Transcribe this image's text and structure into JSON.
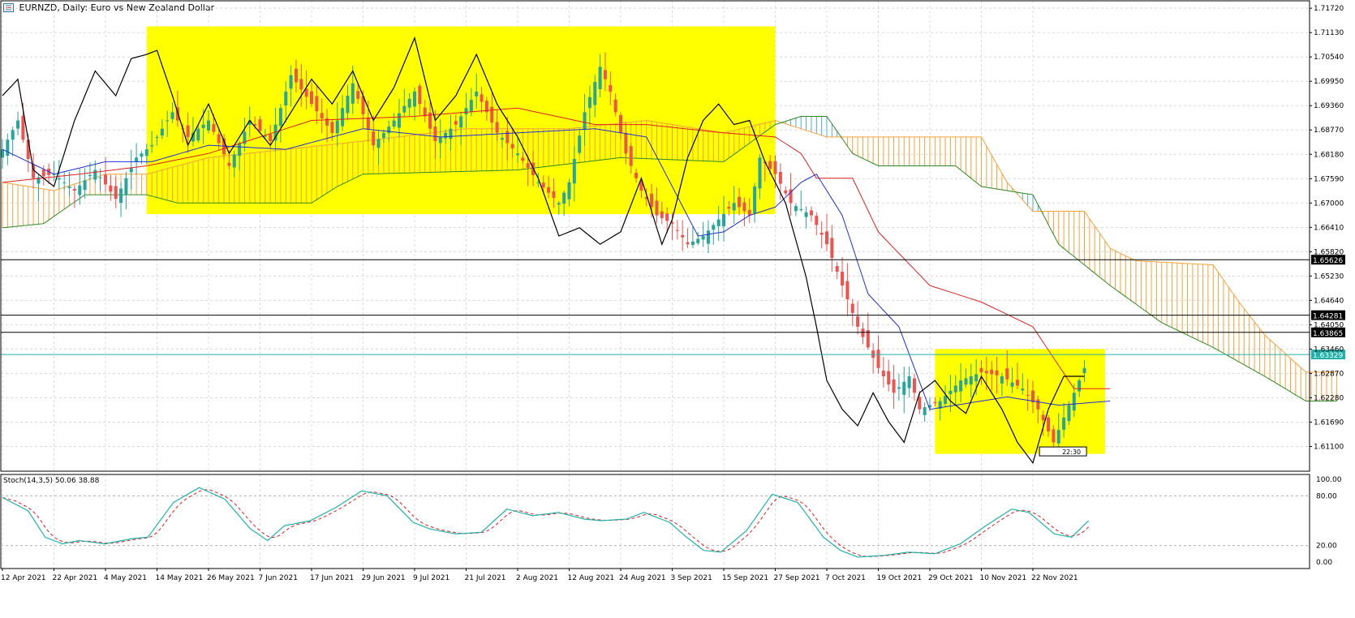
{
  "header": {
    "title": "EURNZD, Daily:  Euro vs New Zealand Dollar"
  },
  "colors": {
    "bull": "#26a69a",
    "bear": "#ef5350",
    "tenkan": "#e02020",
    "kijun": "#1f2fd6",
    "chikou": "#000000",
    "span_a": "#f5a23a",
    "span_b": "#2e8b22",
    "highlight": "#ffff00",
    "stoch_main": "#20b2aa",
    "stoch_signal": "#e02020"
  },
  "indicator": {
    "label": "Stoch(14,3,5) 50.06 38.88"
  },
  "chart_data": {
    "type": "candlestick",
    "symbol": "EURNZD",
    "timeframe": "Daily",
    "ylim": [
      1.605,
      1.719
    ],
    "price_ticks": [
      "1.71720",
      "1.71130",
      "1.70540",
      "1.69950",
      "1.69360",
      "1.68770",
      "1.68180",
      "1.67590",
      "1.67000",
      "1.66410",
      "1.65820",
      "1.65230",
      "1.64640",
      "1.64050",
      "1.63460",
      "1.62870",
      "1.62280",
      "1.61690",
      "1.61100"
    ],
    "hlines": [
      {
        "label": "1.65626",
        "value": 1.65626,
        "color": "#000000"
      },
      {
        "label": "1.64281",
        "value": 1.64281,
        "color": "#000000"
      },
      {
        "label": "1.63865",
        "value": 1.63865,
        "color": "#000000"
      },
      {
        "label": "1.63329",
        "value": 1.63329,
        "color": "#20b2aa"
      }
    ],
    "date_labels": [
      "12 Apr 2021",
      "22 Apr 2021",
      "4 May 2021",
      "14 May 2021",
      "26 May 2021",
      "7 Jun 2021",
      "17 Jun 2021",
      "29 Jun 2021",
      "9 Jul 2021",
      "21 Jul 2021",
      "2 Aug 2021",
      "12 Aug 2021",
      "24 Aug 2021",
      "3 Sep 2021",
      "15 Sep 2021",
      "27 Sep 2021",
      "7 Oct 2021",
      "19 Oct 2021",
      "29 Oct 2021",
      "10 Nov 2021",
      "22 Nov 2021"
    ],
    "highlight_boxes": [
      {
        "from_index": 28,
        "to_index": 150,
        "top": 1.7128,
        "bottom": 1.6673
      },
      {
        "from_index": 181,
        "to_index": 214,
        "top": 1.6346,
        "bottom": 1.6092
      }
    ],
    "countdown": "22:30",
    "stoch_ticks": [
      "100.00",
      "80.00",
      "20.00",
      "0.00"
    ],
    "stoch_ylim": [
      0,
      100
    ],
    "stoch_levels": [
      80,
      20
    ]
  }
}
